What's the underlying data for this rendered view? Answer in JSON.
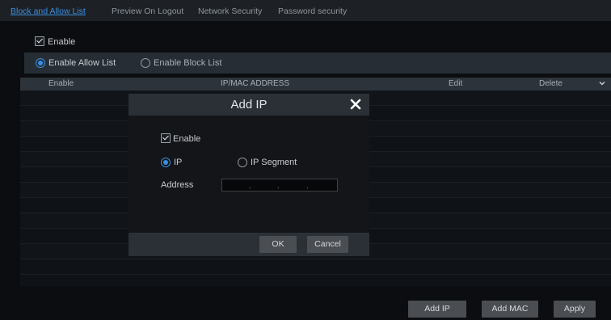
{
  "tabs": [
    {
      "label": "Block and Allow List",
      "active": true
    },
    {
      "label": "Preview On Logout",
      "active": false
    },
    {
      "label": "Network Security",
      "active": false
    },
    {
      "label": "Password security",
      "active": false
    }
  ],
  "enable": {
    "label": "Enable",
    "checked": true
  },
  "mode": {
    "allow_label": "Enable Allow List",
    "block_label": "Enable Block List",
    "selected": "allow"
  },
  "table": {
    "headers": {
      "enable": "Enable",
      "address": "IP/MAC ADDRESS",
      "edit": "Edit",
      "delete": "Delete"
    },
    "rows": []
  },
  "buttons": {
    "add_ip": "Add IP",
    "add_mac": "Add MAC",
    "apply": "Apply"
  },
  "dialog": {
    "title": "Add IP",
    "enable_label": "Enable",
    "enable_checked": true,
    "type_ip_label": "IP",
    "type_segment_label": "IP Segment",
    "selected_type": "ip",
    "address_label": "Address",
    "address_value": "",
    "ok_label": "OK",
    "cancel_label": "Cancel"
  },
  "colors": {
    "accent": "#3a8fe0",
    "background": "#0b0d10",
    "panel": "#262d34",
    "button": "#4a4e53"
  },
  "icons": {
    "close": "close-icon",
    "chevron": "chevron-down-icon"
  }
}
